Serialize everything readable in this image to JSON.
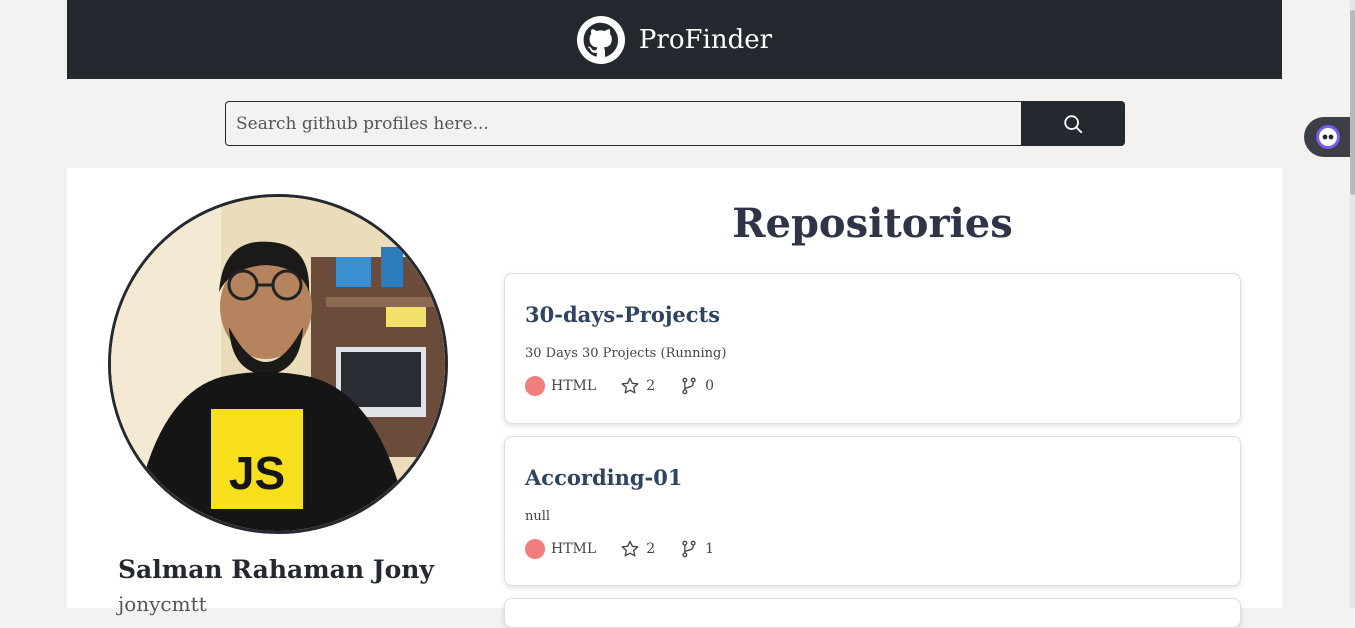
{
  "header": {
    "brand": "ProFinder",
    "logo_icon": "github-icon"
  },
  "search": {
    "placeholder": "Search github profiles here...",
    "value": "",
    "button_icon": "search-icon"
  },
  "profile": {
    "name": "Salman Rahaman Jony",
    "login": "jonycmtt"
  },
  "repositories": {
    "title": "Repositories",
    "items": [
      {
        "name": "30-days-Projects",
        "description": "30 Days 30 Projects (Running)",
        "language": "HTML",
        "language_color": "#f07e7e",
        "stars": "2",
        "forks": "0"
      },
      {
        "name": "According-01",
        "description": "null",
        "language": "HTML",
        "language_color": "#f07e7e",
        "stars": "2",
        "forks": "1"
      }
    ]
  },
  "colors": {
    "header_bg": "#24292f",
    "page_bg": "#f3f2f0",
    "title": "#2f3447"
  }
}
